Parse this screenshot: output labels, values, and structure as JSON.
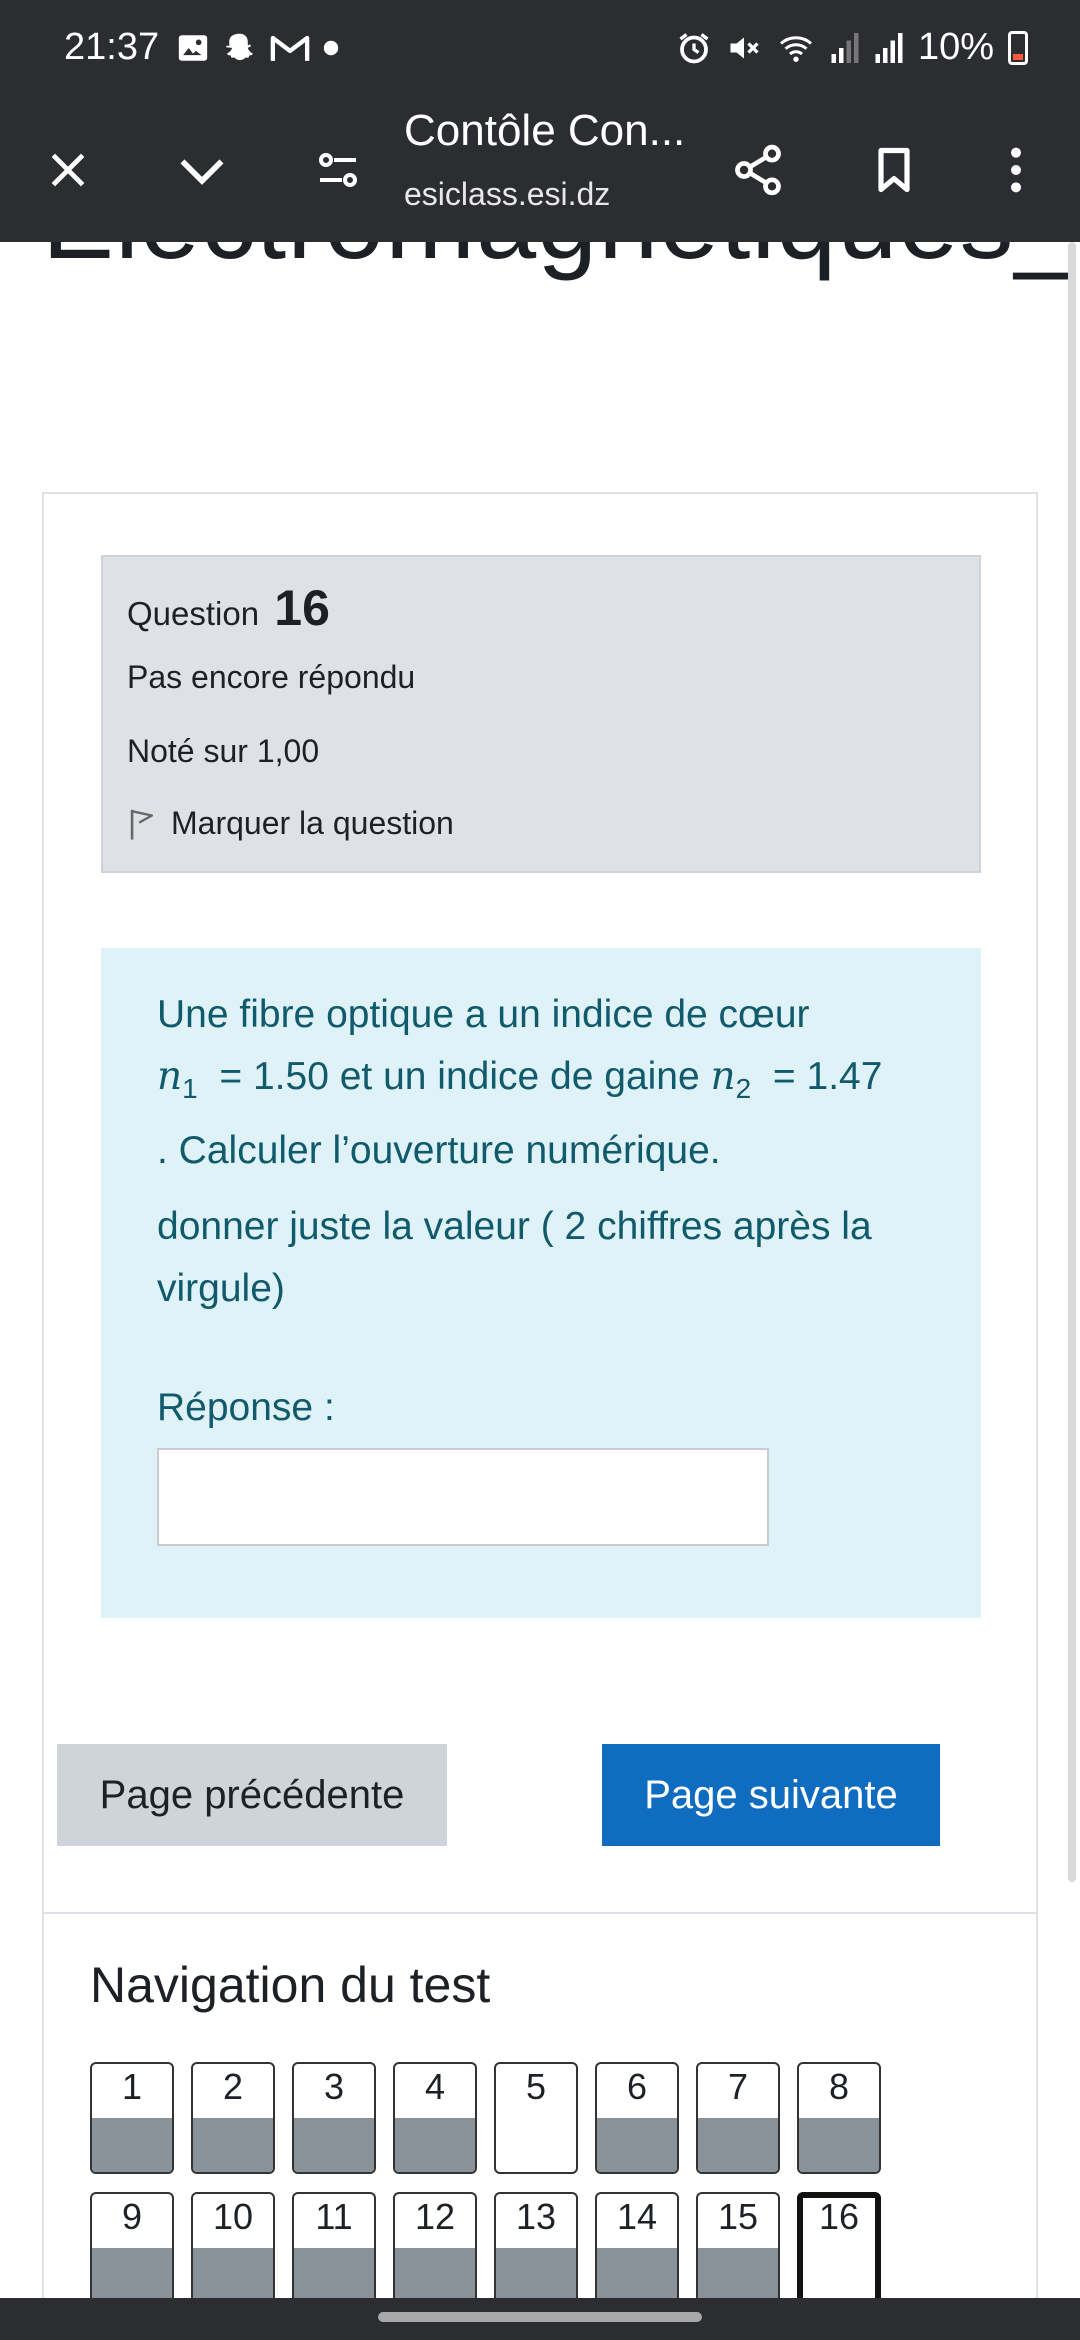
{
  "status_bar": {
    "time": "21:37",
    "battery": "10%",
    "left_icons": [
      "gallery-icon",
      "snapchat-icon",
      "gmail-icon",
      "dot-icon"
    ],
    "right_icons": [
      "alarm-icon",
      "mute-icon",
      "wifi-icon",
      "signal-icon",
      "signal-icon",
      "battery-icon"
    ]
  },
  "browser": {
    "page_title": "Contôle Con...",
    "domain": "esiclass.esi.dz",
    "icons": [
      "close-icon",
      "chevron-down-icon",
      "page-settings-icon",
      "share-icon",
      "bookmark-icon",
      "more-icon"
    ]
  },
  "page": {
    "heading": "Electromagnétiques_("
  },
  "question": {
    "label": "Question",
    "number": "16",
    "state": "Pas encore répondu",
    "grade": "Noté sur 1,00",
    "flag_label": "Marquer la question",
    "text_part1": "Une fibre optique a un indice de cœur",
    "n1_symbol": "n",
    "n1_sub": "1",
    "n1_value": " = 1.50 et un indice de gaine ",
    "n2_symbol": "n",
    "n2_sub": "2",
    "n2_value": " = 1.47",
    "text_part2": ". Calculer l’ouverture numérique.",
    "hint": "donner juste la valeur ( 2 chiffres après la virgule)",
    "answer_label": "Réponse :",
    "answer_value": ""
  },
  "buttons": {
    "prev": "Page précédente",
    "next": "Page suivante"
  },
  "navigation": {
    "title": "Navigation du test",
    "items": [
      {
        "label": "1",
        "answered": true,
        "current": false
      },
      {
        "label": "2",
        "answered": true,
        "current": false
      },
      {
        "label": "3",
        "answered": true,
        "current": false
      },
      {
        "label": "4",
        "answered": true,
        "current": false
      },
      {
        "label": "5",
        "answered": false,
        "current": false
      },
      {
        "label": "6",
        "answered": true,
        "current": false
      },
      {
        "label": "7",
        "answered": true,
        "current": false
      },
      {
        "label": "8",
        "answered": true,
        "current": false
      },
      {
        "label": "9",
        "answered": true,
        "current": false
      },
      {
        "label": "10",
        "answered": true,
        "current": false
      },
      {
        "label": "11",
        "answered": true,
        "current": false
      },
      {
        "label": "12",
        "answered": true,
        "current": false
      },
      {
        "label": "13",
        "answered": true,
        "current": false
      },
      {
        "label": "14",
        "answered": true,
        "current": false
      },
      {
        "label": "15",
        "answered": true,
        "current": false
      },
      {
        "label": "16",
        "answered": false,
        "current": true
      }
    ]
  },
  "colors": {
    "toolbar_bg": "#2b2d31",
    "info_bg": "#dee2e6",
    "content_bg": "#def2f8",
    "content_text": "#115a6c",
    "primary_button": "#0f6cbf",
    "secondary_button": "#ced4da",
    "answered_fill": "#8a9299"
  }
}
